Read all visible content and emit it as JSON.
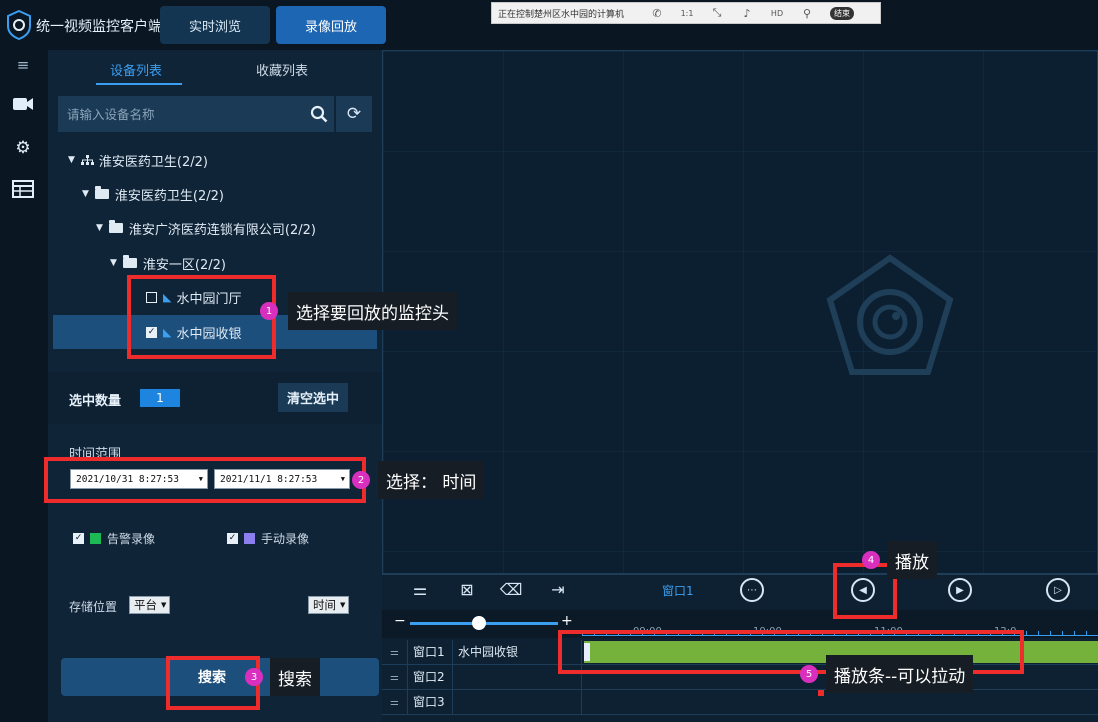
{
  "app": {
    "title": "统一视频监控客户端"
  },
  "top_tabs": {
    "live": "实时浏览",
    "playback": "录像回放"
  },
  "remote_bar": {
    "text": "正在控制楚州区水中园的计算机",
    "zoom_label": "1:1",
    "hd_label": "HD",
    "end_label": "结束"
  },
  "left_panel": {
    "tabs": {
      "devices": "设备列表",
      "favorites": "收藏列表"
    },
    "search_placeholder": "请输入设备名称",
    "tree": [
      {
        "label": "淮安医药卫生(2/2)"
      },
      {
        "label": "淮安医药卫生(2/2)"
      },
      {
        "label": "淮安广济医药连锁有限公司(2/2)"
      },
      {
        "label": "淮安一区(2/2)"
      },
      {
        "label": "水中园门厅",
        "checked": false
      },
      {
        "label": "水中园收银",
        "checked": true
      }
    ],
    "selection": {
      "label": "选中数量",
      "count": "1",
      "clear": "清空选中"
    },
    "time_range": {
      "label": "时间范围",
      "start": "2021/10/31 8:27:53",
      "end": "2021/11/1 8:27:53"
    },
    "record_types": {
      "alarm": "告警录像",
      "manual": "手动录像",
      "alarm_color": "#1db954",
      "manual_color": "#8b7ff0"
    },
    "storage": {
      "label": "存储位置",
      "value": "平台",
      "sort": "时间"
    },
    "search_button": "搜索"
  },
  "playback": {
    "window_label": "窗口1",
    "ticks": [
      "09:00",
      "10:00",
      "11:00",
      "12:0"
    ],
    "tracks": [
      {
        "window": "窗口1",
        "camera": "水中园收银"
      },
      {
        "window": "窗口2",
        "camera": ""
      },
      {
        "window": "窗口3",
        "camera": ""
      }
    ]
  },
  "annotations": [
    {
      "num": "1",
      "text": "选择要回放的监控头"
    },
    {
      "num": "2",
      "text": "选择： 时间"
    },
    {
      "num": "3",
      "text": "搜索"
    },
    {
      "num": "4",
      "text": "播放"
    },
    {
      "num": "5",
      "text": "播放条--可以拉动"
    }
  ],
  "colors": {
    "accent": "#3b9ef0",
    "annotation_red": "#ee2c2c",
    "badge_magenta": "#d92fbf",
    "timeline_green": "#74b23c"
  }
}
